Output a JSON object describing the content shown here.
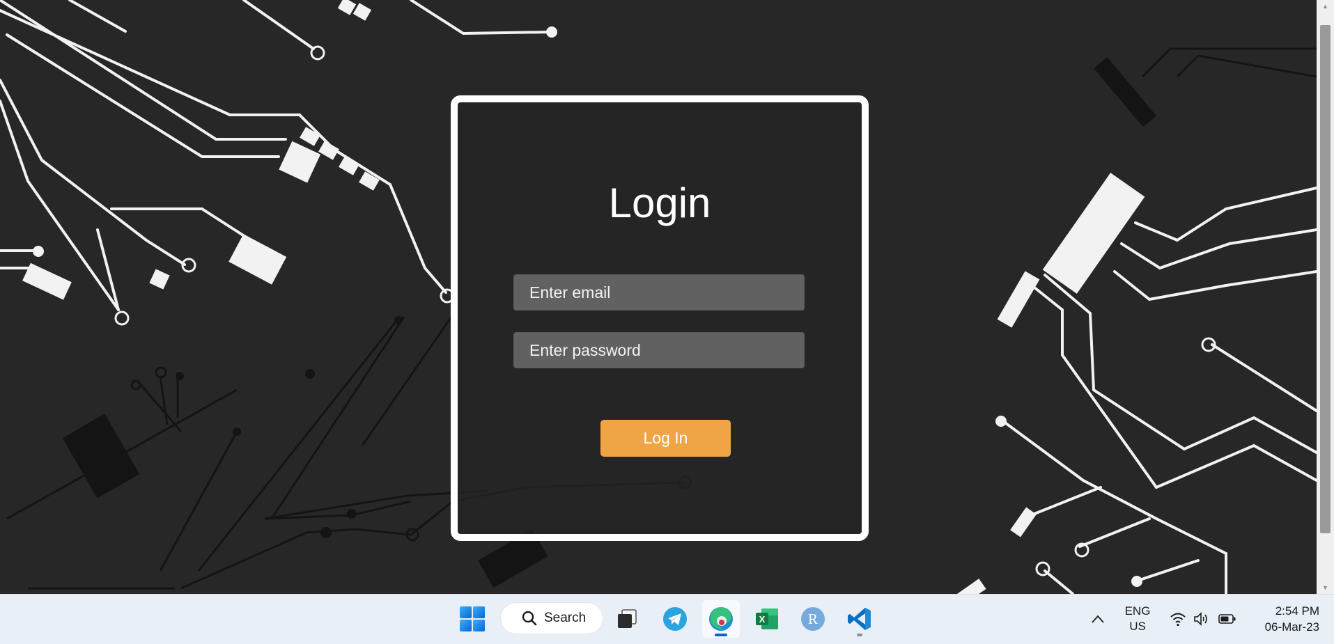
{
  "login": {
    "title": "Login",
    "email_placeholder": "Enter email",
    "password_placeholder": "Enter password",
    "submit_label": "Log In"
  },
  "colors": {
    "accent": "#f0a446",
    "card_border": "#ffffff",
    "field_bg": "#616161",
    "background": "#262626"
  },
  "taskbar": {
    "search_label": "Search",
    "apps": [
      {
        "icon": "windows-start-icon"
      },
      {
        "icon": "task-view-icon"
      },
      {
        "icon": "telegram-icon"
      },
      {
        "icon": "edge-browser-icon",
        "active": true
      },
      {
        "icon": "excel-icon"
      },
      {
        "icon": "r-language-icon"
      },
      {
        "icon": "vscode-icon",
        "running": true
      }
    ],
    "tray": {
      "language_top": "ENG",
      "language_bottom": "US",
      "time": "2:54 PM",
      "date": "06-Mar-23",
      "icons": [
        "chevron-up-icon",
        "wifi-icon",
        "volume-icon",
        "battery-icon"
      ]
    }
  }
}
